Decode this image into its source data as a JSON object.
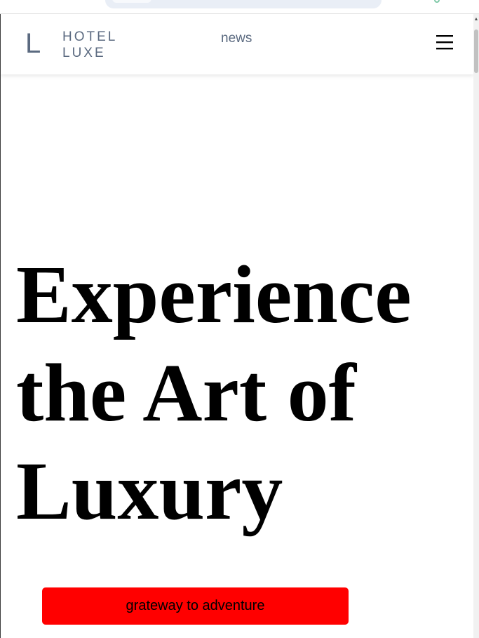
{
  "brand": {
    "logo_letter": "L",
    "name_line1": "HOTEL",
    "name_line2": "LUXE"
  },
  "nav": {
    "link_label": "news",
    "menu_icon": "hamburger-menu-icon"
  },
  "hero": {
    "line1": "Experience",
    "line2": "the Art of",
    "line3": "Luxury"
  },
  "cta": {
    "label": "grateway to adventure"
  },
  "colors": {
    "brand_text": "#5b6a80",
    "cta_background": "#ff0000",
    "heading": "#000000"
  }
}
